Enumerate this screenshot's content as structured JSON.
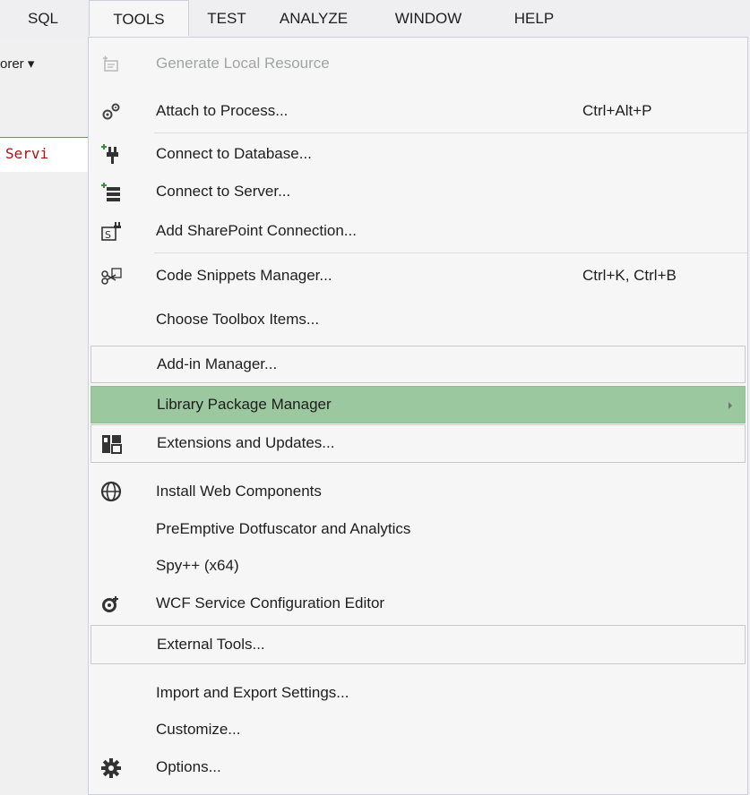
{
  "menubar": {
    "items": [
      {
        "label": "SQL"
      },
      {
        "label": "TOOLS"
      },
      {
        "label": "TEST"
      },
      {
        "label": "ANALYZE"
      },
      {
        "label": "WINDOW"
      },
      {
        "label": "HELP"
      }
    ]
  },
  "background": {
    "toolbar_text": "orer ▾",
    "code_text": "Servi"
  },
  "menu": {
    "items": [
      {
        "label": "Generate Local Resource",
        "icon": "resource-icon",
        "disabled": true
      },
      {
        "label": "Attach to Process...",
        "shortcut": "Ctrl+Alt+P",
        "icon": "gears-icon"
      },
      {
        "label": "Connect to Database...",
        "icon": "database-connect-icon"
      },
      {
        "label": "Connect to Server...",
        "icon": "server-connect-icon"
      },
      {
        "label": "Add SharePoint Connection...",
        "icon": "sharepoint-icon"
      },
      {
        "label": "Code Snippets Manager...",
        "shortcut": "Ctrl+K, Ctrl+B",
        "icon": "snippets-icon"
      },
      {
        "label": "Choose Toolbox Items..."
      },
      {
        "label": "Add-in Manager..."
      },
      {
        "label": "Library Package Manager",
        "submenu": true,
        "highlighted": true
      },
      {
        "label": "Extensions and Updates...",
        "icon": "extensions-icon"
      },
      {
        "label": "Install Web Components",
        "icon": "web-components-icon"
      },
      {
        "label": "PreEmptive Dotfuscator and Analytics"
      },
      {
        "label": "Spy++ (x64)"
      },
      {
        "label": "WCF Service Configuration Editor",
        "icon": "wcf-config-icon"
      },
      {
        "label": "External Tools..."
      },
      {
        "label": "Import and Export Settings..."
      },
      {
        "label": "Customize..."
      },
      {
        "label": "Options...",
        "icon": "gear-icon"
      }
    ]
  },
  "colors": {
    "highlight": "#9cc8a0",
    "disabled_text": "#a2a4a5",
    "code_red": "#a31515"
  }
}
